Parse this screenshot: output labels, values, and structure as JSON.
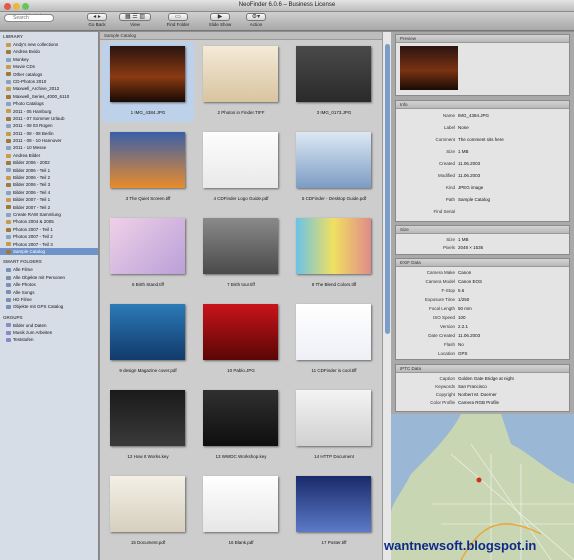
{
  "window": {
    "title": "NeoFinder 6.0.6 – Business License"
  },
  "toolbar": {
    "search_placeholder": "Search",
    "search_label": "Quick Find",
    "buttons": [
      {
        "label": "Go Back",
        "icon": "back-forward-icon"
      },
      {
        "label": "View",
        "icon": "view-icon"
      },
      {
        "label": "Find Folder",
        "icon": "find-folder-icon"
      },
      {
        "label": "Slide Show",
        "icon": "slideshow-icon"
      },
      {
        "label": "Action",
        "icon": "gear-icon"
      }
    ]
  },
  "sidebar": {
    "library_title": "LIBRARY",
    "library": [
      "Andy's new collections",
      "Andrea Bvido",
      "Monkey",
      "Movie CDs",
      "Other catalogs",
      "CD-Photos 2010",
      "Maxwell_Archive_2012",
      "Maxwell_Series_4000_6110",
      "Photo Catalogs",
      "2011 - 05 Hamburg",
      "2011 - 07 Sommer Urlaub",
      "2011 - 08 03 Rügen",
      "2011 - 08 - 08 Berlin",
      "2011 - 08 - 10 Hannover",
      "2011 - 10 Messe",
      "Andrea Bilder",
      "Bilder 2006 - 2002",
      "Bilder 2006 - Teil 1",
      "Bilder 2006 - Teil 2",
      "Bilder 2006 - Teil 3",
      "Bilder 2006 - Teil 4",
      "Bilder 2007 - Teil 1",
      "Bilder 2007 - Teil 2",
      "Create RAW Sammlung",
      "Photos 2004 & 2005",
      "Photos 2007 - Teil 1",
      "Photos 2007 - Teil 2",
      "Photos 2007 - Teil 3",
      "Sample Catalog"
    ],
    "smart_title": "SMART FOLDERS",
    "smart": [
      "Alle Filme",
      "Alle Objekte mit Personen",
      "Alle Photos",
      "Alle Songs",
      "HD Filme",
      "Objekte mit GPS Catalog"
    ],
    "groups_title": "GROUPS",
    "groups": [
      "Bilder und Daten",
      "Musik zum Arbeiten",
      "Teststufen"
    ]
  },
  "grid": {
    "header": "Sample Catalog",
    "items": [
      {
        "caption": "1 IMG_4384.JPG"
      },
      {
        "caption": "2 Photos in Finder.TIFF"
      },
      {
        "caption": "3 IMG_0173.JPG"
      },
      {
        "caption": "3 The Quiet Screen.tiff"
      },
      {
        "caption": "4 CDFinder Logo Guide.pdf"
      },
      {
        "caption": "5 CDFinder - Desktop Guide.pdf"
      },
      {
        "caption": "6 Birth Stand.tiff"
      },
      {
        "caption": "7 Birth tour.tiff"
      },
      {
        "caption": "8 The Blend Colors.tiff"
      },
      {
        "caption": "9 design Magazine cover.pdf"
      },
      {
        "caption": "10 Pablo.JPG"
      },
      {
        "caption": "11 CDFinder is cool.tiff"
      },
      {
        "caption": "12 How It Works.key"
      },
      {
        "caption": "13 WWDC Workshop.key"
      },
      {
        "caption": "14 HTTP Document"
      },
      {
        "caption": "15 Document.pdf"
      },
      {
        "caption": "16 Blank.pdf"
      },
      {
        "caption": "17 Poster.tiff"
      }
    ]
  },
  "inspector": {
    "preview_title": "Preview",
    "info_title": "Info",
    "info": [
      {
        "k": "Name",
        "v": "IMG_4384.JPG"
      },
      {
        "k": "Label",
        "v": "None"
      },
      {
        "k": "Comment",
        "v": "The comment sits here"
      },
      {
        "k": "Size",
        "v": "1 MB"
      },
      {
        "k": "Created",
        "v": "11.06.2003"
      },
      {
        "k": "Modified",
        "v": "11.06.2003"
      },
      {
        "k": "Kind",
        "v": "JPEG image"
      },
      {
        "k": "Path",
        "v": "Sample Catalog"
      },
      {
        "k": "Find Serial",
        "v": ""
      }
    ],
    "size_title": "Size",
    "size": [
      {
        "k": "Size",
        "v": "1 MB"
      },
      {
        "k": "Pixels",
        "v": "2048 × 1536"
      }
    ],
    "exif_title": "EXIF Data",
    "exif": [
      {
        "k": "Camera Make",
        "v": "Canon"
      },
      {
        "k": "Camera Model",
        "v": "Canon EOS"
      },
      {
        "k": "F-Stop",
        "v": "5.6"
      },
      {
        "k": "Exposure Time",
        "v": "1/250"
      },
      {
        "k": "Focal Length",
        "v": "50 mm"
      },
      {
        "k": "ISO Speed",
        "v": "100"
      },
      {
        "k": "Version",
        "v": "2.2.1"
      },
      {
        "k": "Date Created",
        "v": "11.06.2003"
      },
      {
        "k": "Flash",
        "v": "No"
      },
      {
        "k": "Location",
        "v": "GPS"
      }
    ],
    "iptc_title": "IPTC Data",
    "iptc": [
      {
        "k": "Caption",
        "v": "Golden Gate Bridge at night"
      },
      {
        "k": "Keywords",
        "v": "San Francisco"
      },
      {
        "k": "Copyright",
        "v": "Norbert M. Doerner"
      },
      {
        "k": "Color Profile",
        "v": "Camera RGB Profile"
      }
    ]
  },
  "watermark": "wantnewsoft.blogspot.in"
}
